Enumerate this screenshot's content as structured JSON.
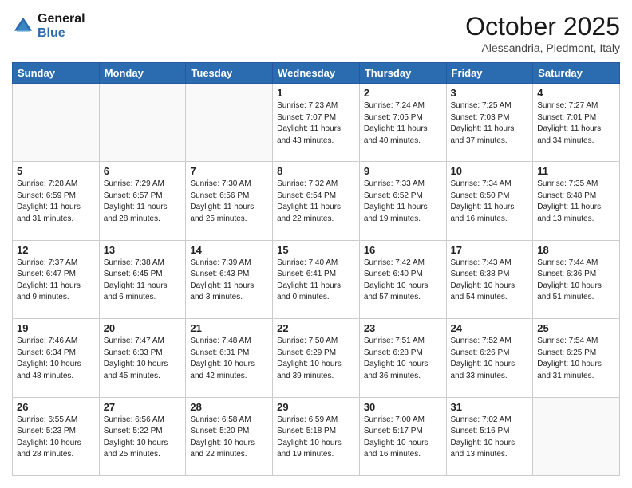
{
  "header": {
    "logo_line1": "General",
    "logo_line2": "Blue",
    "month": "October 2025",
    "location": "Alessandria, Piedmont, Italy"
  },
  "days_of_week": [
    "Sunday",
    "Monday",
    "Tuesday",
    "Wednesday",
    "Thursday",
    "Friday",
    "Saturday"
  ],
  "weeks": [
    [
      {
        "day": "",
        "info": ""
      },
      {
        "day": "",
        "info": ""
      },
      {
        "day": "",
        "info": ""
      },
      {
        "day": "1",
        "info": "Sunrise: 7:23 AM\nSunset: 7:07 PM\nDaylight: 11 hours\nand 43 minutes."
      },
      {
        "day": "2",
        "info": "Sunrise: 7:24 AM\nSunset: 7:05 PM\nDaylight: 11 hours\nand 40 minutes."
      },
      {
        "day": "3",
        "info": "Sunrise: 7:25 AM\nSunset: 7:03 PM\nDaylight: 11 hours\nand 37 minutes."
      },
      {
        "day": "4",
        "info": "Sunrise: 7:27 AM\nSunset: 7:01 PM\nDaylight: 11 hours\nand 34 minutes."
      }
    ],
    [
      {
        "day": "5",
        "info": "Sunrise: 7:28 AM\nSunset: 6:59 PM\nDaylight: 11 hours\nand 31 minutes."
      },
      {
        "day": "6",
        "info": "Sunrise: 7:29 AM\nSunset: 6:57 PM\nDaylight: 11 hours\nand 28 minutes."
      },
      {
        "day": "7",
        "info": "Sunrise: 7:30 AM\nSunset: 6:56 PM\nDaylight: 11 hours\nand 25 minutes."
      },
      {
        "day": "8",
        "info": "Sunrise: 7:32 AM\nSunset: 6:54 PM\nDaylight: 11 hours\nand 22 minutes."
      },
      {
        "day": "9",
        "info": "Sunrise: 7:33 AM\nSunset: 6:52 PM\nDaylight: 11 hours\nand 19 minutes."
      },
      {
        "day": "10",
        "info": "Sunrise: 7:34 AM\nSunset: 6:50 PM\nDaylight: 11 hours\nand 16 minutes."
      },
      {
        "day": "11",
        "info": "Sunrise: 7:35 AM\nSunset: 6:48 PM\nDaylight: 11 hours\nand 13 minutes."
      }
    ],
    [
      {
        "day": "12",
        "info": "Sunrise: 7:37 AM\nSunset: 6:47 PM\nDaylight: 11 hours\nand 9 minutes."
      },
      {
        "day": "13",
        "info": "Sunrise: 7:38 AM\nSunset: 6:45 PM\nDaylight: 11 hours\nand 6 minutes."
      },
      {
        "day": "14",
        "info": "Sunrise: 7:39 AM\nSunset: 6:43 PM\nDaylight: 11 hours\nand 3 minutes."
      },
      {
        "day": "15",
        "info": "Sunrise: 7:40 AM\nSunset: 6:41 PM\nDaylight: 11 hours\nand 0 minutes."
      },
      {
        "day": "16",
        "info": "Sunrise: 7:42 AM\nSunset: 6:40 PM\nDaylight: 10 hours\nand 57 minutes."
      },
      {
        "day": "17",
        "info": "Sunrise: 7:43 AM\nSunset: 6:38 PM\nDaylight: 10 hours\nand 54 minutes."
      },
      {
        "day": "18",
        "info": "Sunrise: 7:44 AM\nSunset: 6:36 PM\nDaylight: 10 hours\nand 51 minutes."
      }
    ],
    [
      {
        "day": "19",
        "info": "Sunrise: 7:46 AM\nSunset: 6:34 PM\nDaylight: 10 hours\nand 48 minutes."
      },
      {
        "day": "20",
        "info": "Sunrise: 7:47 AM\nSunset: 6:33 PM\nDaylight: 10 hours\nand 45 minutes."
      },
      {
        "day": "21",
        "info": "Sunrise: 7:48 AM\nSunset: 6:31 PM\nDaylight: 10 hours\nand 42 minutes."
      },
      {
        "day": "22",
        "info": "Sunrise: 7:50 AM\nSunset: 6:29 PM\nDaylight: 10 hours\nand 39 minutes."
      },
      {
        "day": "23",
        "info": "Sunrise: 7:51 AM\nSunset: 6:28 PM\nDaylight: 10 hours\nand 36 minutes."
      },
      {
        "day": "24",
        "info": "Sunrise: 7:52 AM\nSunset: 6:26 PM\nDaylight: 10 hours\nand 33 minutes."
      },
      {
        "day": "25",
        "info": "Sunrise: 7:54 AM\nSunset: 6:25 PM\nDaylight: 10 hours\nand 31 minutes."
      }
    ],
    [
      {
        "day": "26",
        "info": "Sunrise: 6:55 AM\nSunset: 5:23 PM\nDaylight: 10 hours\nand 28 minutes."
      },
      {
        "day": "27",
        "info": "Sunrise: 6:56 AM\nSunset: 5:22 PM\nDaylight: 10 hours\nand 25 minutes."
      },
      {
        "day": "28",
        "info": "Sunrise: 6:58 AM\nSunset: 5:20 PM\nDaylight: 10 hours\nand 22 minutes."
      },
      {
        "day": "29",
        "info": "Sunrise: 6:59 AM\nSunset: 5:18 PM\nDaylight: 10 hours\nand 19 minutes."
      },
      {
        "day": "30",
        "info": "Sunrise: 7:00 AM\nSunset: 5:17 PM\nDaylight: 10 hours\nand 16 minutes."
      },
      {
        "day": "31",
        "info": "Sunrise: 7:02 AM\nSunset: 5:16 PM\nDaylight: 10 hours\nand 13 minutes."
      },
      {
        "day": "",
        "info": ""
      }
    ]
  ]
}
